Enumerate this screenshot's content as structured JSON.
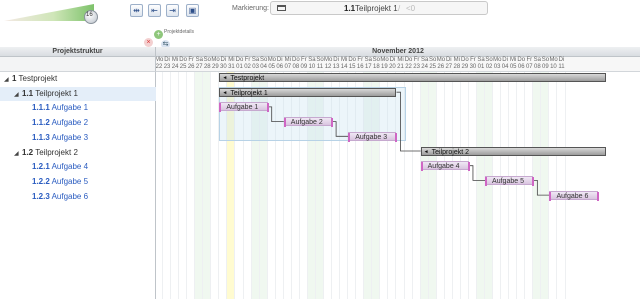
{
  "toolbar": {
    "zoom_value": "16",
    "buttons": [
      "collapse-columns-icon",
      "scroll-start-icon",
      "scroll-end-icon",
      "maximize-icon"
    ],
    "marking_label": "Markierung:",
    "marked_code": "1.1",
    "marked_name": "Teilprojekt 1",
    "marked_sep": "/",
    "marked_count": "<0"
  },
  "details": {
    "label": "Projektdetails"
  },
  "panel": {
    "header": "Projektstruktur"
  },
  "tree": {
    "rows": [
      {
        "code": "1",
        "label": "Testprojekt",
        "level": 0,
        "leaf": false,
        "selected": false
      },
      {
        "code": "1.1",
        "label": "Teilprojekt 1",
        "level": 1,
        "leaf": false,
        "selected": true
      },
      {
        "code": "1.1.1",
        "label": "Aufgabe 1",
        "level": 2,
        "leaf": true,
        "selected": false
      },
      {
        "code": "1.1.2",
        "label": "Aufgabe 2",
        "level": 2,
        "leaf": true,
        "selected": false
      },
      {
        "code": "1.1.3",
        "label": "Aufgabe 3",
        "level": 2,
        "leaf": true,
        "selected": false
      },
      {
        "code": "1.2",
        "label": "Teilprojekt 2",
        "level": 1,
        "leaf": false,
        "selected": false
      },
      {
        "code": "1.2.1",
        "label": "Aufgabe 4",
        "level": 2,
        "leaf": true,
        "selected": false
      },
      {
        "code": "1.2.2",
        "label": "Aufgabe 5",
        "level": 2,
        "leaf": true,
        "selected": false
      },
      {
        "code": "1.2.3",
        "label": "Aufgabe 6",
        "level": 2,
        "leaf": true,
        "selected": false
      }
    ]
  },
  "timeline": {
    "month": "November 2012",
    "weekdays": [
      "Mo",
      "Di",
      "Mi",
      "Do",
      "Fr",
      "Sa",
      "So",
      "Mo",
      "Di",
      "Mi",
      "Do",
      "Fr",
      "Sa",
      "So",
      "Mo",
      "Di",
      "Mi",
      "Do",
      "Fr",
      "Sa",
      "So",
      "Mo",
      "Di",
      "Mi",
      "Do",
      "Fr",
      "Sa",
      "So",
      "Mo",
      "Di",
      "Mi",
      "Do",
      "Fr",
      "Sa",
      "So",
      "Mo",
      "Di",
      "Mi",
      "Do",
      "Fr",
      "Sa",
      "So",
      "Mo",
      "Di",
      "Mi",
      "Do",
      "Fr",
      "Sa",
      "So",
      "Mo",
      "Di",
      "Mi",
      "Do",
      "Fr",
      "Sa",
      "So",
      "Mo",
      "Di",
      "Mi",
      "Do"
    ],
    "days": [
      "22",
      "23",
      "24",
      "25",
      "26",
      "27",
      "28",
      "29",
      "30",
      "31",
      "01",
      "02",
      "03",
      "04",
      "05",
      "06",
      "07",
      "08",
      "09",
      "10",
      "11",
      "12",
      "13",
      "14",
      "15",
      "16",
      "17",
      "18",
      "19",
      "20",
      "21",
      "22",
      "23",
      "24",
      "25",
      "26",
      "27",
      "28",
      "29",
      "30",
      "01",
      "02",
      "03",
      "04",
      "05",
      "06",
      "07",
      "08",
      "09",
      "10",
      "11"
    ]
  },
  "bars": [
    {
      "label": "Testprojekt",
      "type": "summary",
      "start": 8,
      "end": 56,
      "row": 0
    },
    {
      "label": "Teilprojekt 1",
      "type": "summary",
      "start": 8,
      "end": 30,
      "row": 1
    },
    {
      "label": "Aufgabe 1",
      "type": "task",
      "start": 8,
      "end": 14,
      "row": 2
    },
    {
      "label": "Aufgabe 2",
      "type": "task",
      "start": 16,
      "end": 22,
      "row": 3
    },
    {
      "label": "Aufgabe 3",
      "type": "task",
      "start": 24,
      "end": 30,
      "row": 4
    },
    {
      "label": "Teilprojekt 2",
      "type": "summary",
      "start": 33,
      "end": 56,
      "row": 5
    },
    {
      "label": "Aufgabe 4",
      "type": "task",
      "start": 33,
      "end": 39,
      "row": 6
    },
    {
      "label": "Aufgabe 5",
      "type": "task",
      "start": 41,
      "end": 47,
      "row": 7
    },
    {
      "label": "Aufgabe 6",
      "type": "task",
      "start": 49,
      "end": 55,
      "row": 8
    }
  ],
  "colors": {
    "accent": "#2a5cc0",
    "selection": "#e4eef9",
    "task_bar": "#d9c4df",
    "task_edge": "#cf66c4",
    "today": "#fffbd0",
    "weekend": "#f0f8f0"
  }
}
